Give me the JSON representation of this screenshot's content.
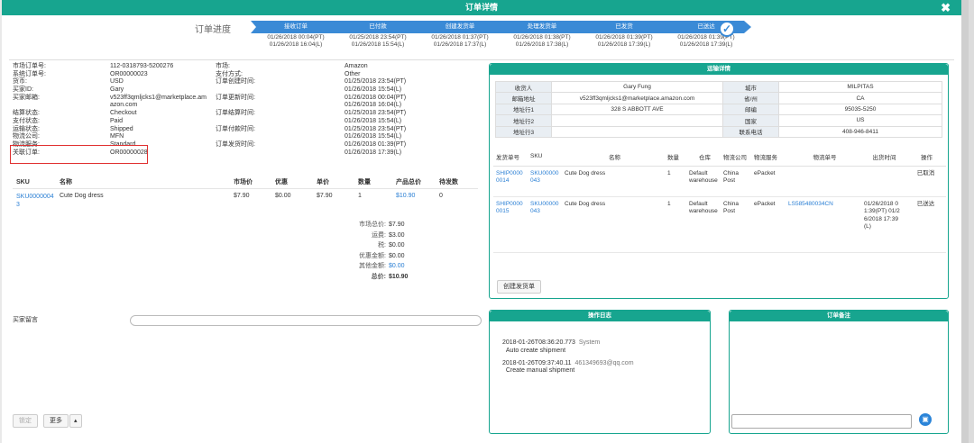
{
  "dialog": {
    "title": "订单详情"
  },
  "progress": {
    "label": "订单进度",
    "steps": [
      {
        "name": "接收订单",
        "d1": "01/26/2018 00:04(PT)",
        "d2": "01/26/2018 16:04(L)"
      },
      {
        "name": "已付款",
        "d1": "01/25/2018 23:54(PT)",
        "d2": "01/26/2018 15:54(L)"
      },
      {
        "name": "创建发货单",
        "d1": "01/26/2018 01:37(PT)",
        "d2": "01/26/2018 17:37(L)"
      },
      {
        "name": "处理发货单",
        "d1": "01/26/2018 01:38(PT)",
        "d2": "01/26/2018 17:38(L)"
      },
      {
        "name": "已发货",
        "d1": "01/26/2018 01:39(PT)",
        "d2": "01/26/2018 17:39(L)"
      },
      {
        "name": "已送达",
        "d1": "01/26/2018 01:39(PT)",
        "d2": "01/26/2018 17:39(L)"
      }
    ]
  },
  "info_rows": [
    [
      "市场订单号:",
      "112-0318793-5200276",
      "市场:",
      "Amazon"
    ],
    [
      "系统订单号:",
      "OR00000023",
      "支付方式:",
      "Other"
    ],
    [
      "货币:",
      "USD",
      "订单创建时间:",
      "01/25/2018 23:54(PT)"
    ],
    [
      "买家ID:",
      "Gary",
      "",
      "01/26/2018 15:54(L)"
    ],
    [
      "买家邮箱:",
      "v523ff3qmljcks1@marketplace.am",
      "订单更新时间:",
      "01/26/2018 00:04(PT)"
    ],
    [
      "",
      "azon.com",
      "",
      "01/26/2018 16:04(L)"
    ],
    [
      "结算状态:",
      "Checkout",
      "订单结算时间:",
      "01/25/2018 23:54(PT)"
    ],
    [
      "支付状态:",
      "Paid",
      "",
      "01/26/2018 15:54(L)"
    ],
    [
      "运输状态:",
      "Shipped",
      "订单付款时间:",
      "01/25/2018 23:54(PT)"
    ],
    [
      "物流公司:",
      "MFN",
      "",
      "01/26/2018 15:54(L)"
    ],
    [
      "物流服务:",
      "Standard",
      "订单发货时间:",
      "01/26/2018 01:39(PT)"
    ],
    [
      "关联订单:",
      "OR00000028",
      "",
      "01/26/2018 17:39(L)"
    ]
  ],
  "items": {
    "headers": [
      "SKU",
      "名称",
      "市场价",
      "优惠",
      "单价",
      "数量",
      "产品总价",
      "待发数"
    ],
    "rows": [
      {
        "sku": "SKU0000004",
        "sku2": "3",
        "name": "Cute Dog dress",
        "market": "$7.90",
        "discount": "$0.00",
        "unit": "$7.90",
        "qty": "1",
        "total": "$10.90",
        "pending": "0"
      }
    ]
  },
  "summary": [
    {
      "k": "市场总价:",
      "v": "$7.90"
    },
    {
      "k": "运费:",
      "v": "$3.00"
    },
    {
      "k": "税:",
      "v": "$0.00"
    },
    {
      "k": "优惠金额:",
      "v": "$0.00"
    },
    {
      "k": "其他金额:",
      "v": "$0.00"
    },
    {
      "k": "总价:",
      "v": "$10.90"
    }
  ],
  "buyer_note_label": "买家留言",
  "buttons": {
    "lock": "锁定",
    "more": "更多",
    "caret": "▴",
    "create": "创建发货单"
  },
  "shipping": {
    "title": "运输详情",
    "kv": [
      [
        "收货人",
        "Gary Fung",
        "城市",
        "MILPITAS"
      ],
      [
        "邮箱地址",
        "v523ff3qmljcks1@marketplace.amazon.com",
        "省/州",
        "CA"
      ],
      [
        "地址行1",
        "328 S ABBOTT AVE",
        "邮编",
        "95035-5250"
      ],
      [
        "地址行2",
        "",
        "国家",
        "US"
      ],
      [
        "地址行3",
        "",
        "联系电话",
        "408-946-8411"
      ]
    ],
    "headers": [
      "发货单号",
      "SKU",
      "名称",
      "数量",
      "仓库",
      "物流公司",
      "物流服务",
      "物流单号",
      "出货时间",
      "操作"
    ],
    "rows": [
      {
        "no": "SHIP00000014",
        "sku": "SKU00000043",
        "name": "Cute Dog dress",
        "qty": "1",
        "wh": "Default warehouse",
        "co": "China Post",
        "svc": "ePacket",
        "track": "",
        "time": "",
        "op": "已取消"
      },
      {
        "no": "SHIP00000015",
        "sku": "SKU00000043",
        "name": "Cute Dog dress",
        "qty": "1",
        "wh": "Default warehouse",
        "co": "China Post",
        "svc": "ePacket",
        "track": "LS585480034CN",
        "time": "01/26/2018 01:39(PT) 01/26/2018 17:39(L)",
        "op": "已送达"
      }
    ]
  },
  "log": {
    "title": "操作日志",
    "entries": [
      {
        "ts": "2018-01-26T08:36:20.773",
        "who": "System",
        "msg": "Auto create shipment"
      },
      {
        "ts": "2018-01-26T09:37:40.11",
        "who": "461349693@qq.com",
        "msg": "Create manual shipment"
      }
    ]
  },
  "memo": {
    "title": "订单备注",
    "save_icon": "save-icon"
  },
  "colors": {
    "teal": "#17a58f",
    "blue": "#3a8ad6",
    "link": "#2a7fd4",
    "red": "#e03030"
  }
}
